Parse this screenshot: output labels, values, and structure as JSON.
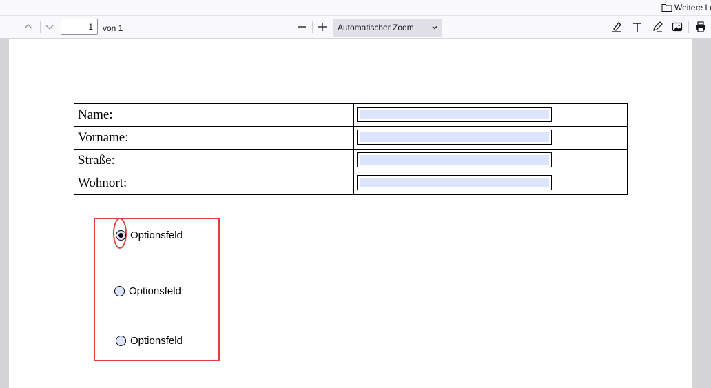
{
  "bookmarks": {
    "folder_label": "Weitere Le"
  },
  "toolbar": {
    "page_number": "1",
    "page_count": "von 1",
    "zoom_label": "Automatischer Zoom"
  },
  "form": {
    "rows": [
      {
        "label": "Name:"
      },
      {
        "label": "Vorname:"
      },
      {
        "label": "Straße:"
      },
      {
        "label": "Wohnort:"
      }
    ],
    "radio_options": [
      {
        "label": "Optionsfeld",
        "checked": true
      },
      {
        "label": "Optionsfeld",
        "checked": false
      },
      {
        "label": "Optionsfeld",
        "checked": false
      }
    ]
  },
  "colors": {
    "field_fill": "#dde4fd",
    "annotation": "#e0403c"
  }
}
